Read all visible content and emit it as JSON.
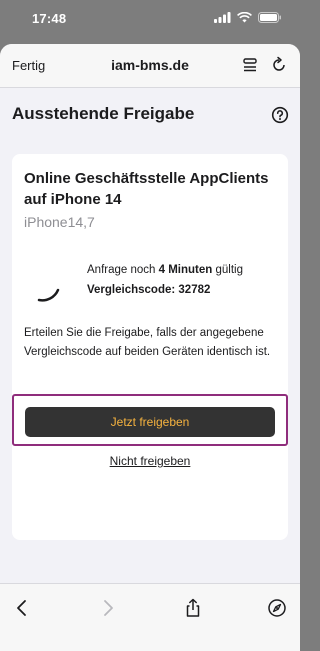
{
  "status_bar": {
    "time": "17:48"
  },
  "nav": {
    "done_label": "Fertig",
    "title": "iam-bms.de"
  },
  "page": {
    "title": "Ausstehende Freigabe"
  },
  "card": {
    "title": "Online Geschäftsstelle AppClients auf iPhone 14",
    "subtitle": "iPhone14,7",
    "request_prefix": "Anfrage noch",
    "request_duration": "4 Minuten",
    "request_suffix": "gültig",
    "code_label": "Vergleichscode: 32782",
    "instruction": "Erteilen Sie die Freigabe, falls der angegebene Vergleichscode auf beiden Geräten identisch ist.",
    "approve_label": "Jetzt freigeben",
    "deny_label": "Nicht freigeben"
  },
  "colors": {
    "approve_bg": "#333333",
    "approve_text": "#f6b33f",
    "highlight_border": "#8f2d7c"
  },
  "icons": {
    "nav": [
      "reader-icon",
      "reload-icon"
    ],
    "header": "help-icon",
    "bottom": [
      "back-icon",
      "forward-icon",
      "share-icon",
      "compass-icon"
    ]
  }
}
